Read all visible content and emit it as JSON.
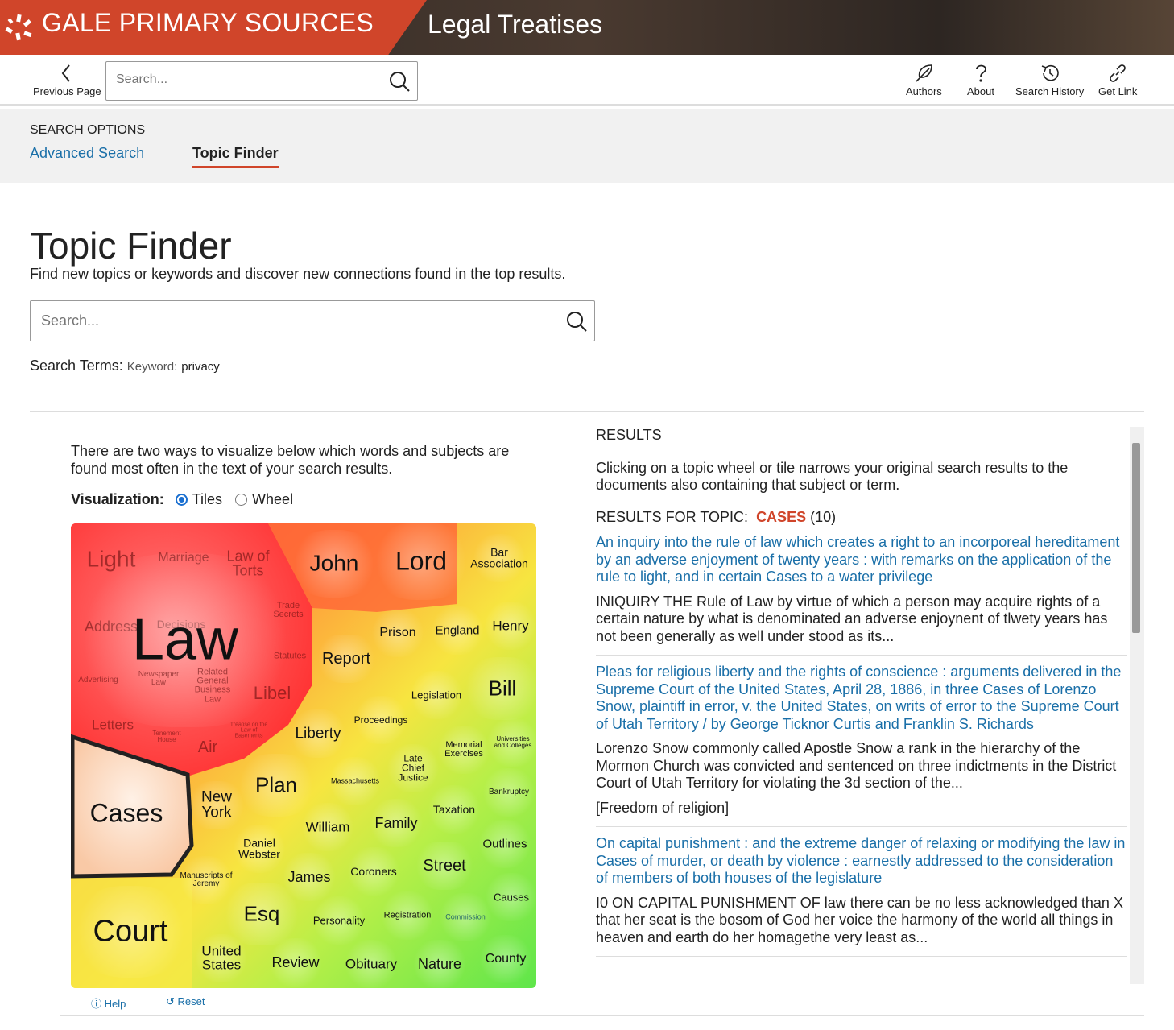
{
  "header": {
    "brand": "GALE PRIMARY SOURCES",
    "product": "Legal Treatises"
  },
  "toolbar": {
    "previous": "Previous Page",
    "search_placeholder": "Search...",
    "items": [
      {
        "label": "Authors",
        "icon": "feather-icon"
      },
      {
        "label": "About",
        "icon": "question-icon"
      },
      {
        "label": "Search History",
        "icon": "history-icon"
      },
      {
        "label": "Get Link",
        "icon": "link-icon"
      }
    ]
  },
  "options": {
    "title": "SEARCH OPTIONS",
    "advanced": "Advanced Search",
    "topic_finder": "Topic Finder"
  },
  "page": {
    "title": "Topic Finder",
    "subtitle": "Find new topics or keywords and discover new connections found in the top results.",
    "search_placeholder": "Search...",
    "terms_label": "Search Terms:",
    "terms_kind": "Keyword:",
    "terms_value": "privacy"
  },
  "viz": {
    "intro": "There are two ways to visualize below which words and subjects are found most often in the text of your search results.",
    "label": "Visualization:",
    "options": [
      "Tiles",
      "Wheel"
    ],
    "selected": "Tiles",
    "help": "Help",
    "reset": "Reset",
    "selected_tile": "Cases",
    "tiles": [
      "Light",
      "Marriage",
      "Law of Torts",
      "John",
      "Lord",
      "Bar Association",
      "Trade Secrets",
      "Address",
      "Decisions",
      "Law",
      "Statutes",
      "Report",
      "Prison",
      "England",
      "Henry",
      "Advertising",
      "Newspaper Law",
      "Related General Business Law",
      "Libel",
      "Legislation",
      "Bill",
      "Letters",
      "Tenement House",
      "Treatise on the Law of Easements",
      "Air",
      "Liberty",
      "Proceedings",
      "Memorial Exercises",
      "Universities and Colleges",
      "Late Chief Justice",
      "Cases",
      "New York",
      "Plan",
      "Massachusetts",
      "Bankruptcy",
      "Taxation",
      "William",
      "Family",
      "Daniel Webster",
      "Outlines",
      "Manuscripts of Jeremy",
      "James",
      "Coroners",
      "Street",
      "Causes",
      "Esq",
      "Personality",
      "Registration",
      "Commission",
      "Court",
      "United States",
      "Review",
      "Obituary",
      "Nature",
      "County"
    ],
    "colors": {
      "high": "#ff3b3b",
      "mid": "#f7e540",
      "low": "#5ee64a",
      "selected": "#fbd3b5"
    }
  },
  "results": {
    "title": "RESULTS",
    "intro": "Clicking on a topic wheel or tile narrows your original search results to the documents also containing that subject or term.",
    "for_topic": "RESULTS FOR TOPIC:",
    "topic": "CASES",
    "count": "(10)",
    "items": [
      {
        "title": "An inquiry into the rule of law which creates a right to an incorporeal hereditament by an adverse enjoyment of twenty years : with remarks on the application of the rule to light, and in certain Cases to a water privilege",
        "snippet": "INIQUIRY THE Rule of Law by virtue of which a person may acquire rights of a certain nature by what is denominated an adverse enjoynent of tlwety years has not been generally as well under stood as its..."
      },
      {
        "title": "Pleas for religious liberty and the rights of conscience : arguments delivered in the Supreme Court of the United States, April 28, 1886, in three Cases of Lorenzo Snow, plaintiff in error, v. the United States, on writs of error to the Supreme Court of Utah Territory / by George Ticknor Curtis and Franklin S. Richards",
        "snippet": "Lorenzo Snow commonly called Apostle Snow a rank in the hierarchy of the Mormon Church was convicted and sentenced on three indictments in the District Court of Utah Territory for violating the 3d section of the...",
        "extra": "[Freedom of religion]"
      },
      {
        "title": "On capital punishment : and the extreme danger of relaxing or modifying the law in Cases of murder, or death by violence : earnestly addressed to the consideration of members of both houses of the legislature",
        "snippet": "I0 ON CAPITAL PUNISHMENT OF law there can be no less acknowledged than X that her seat is the bosom of God her voice the harmony of the world all things in heaven and earth do her homagethe very least as..."
      }
    ]
  }
}
